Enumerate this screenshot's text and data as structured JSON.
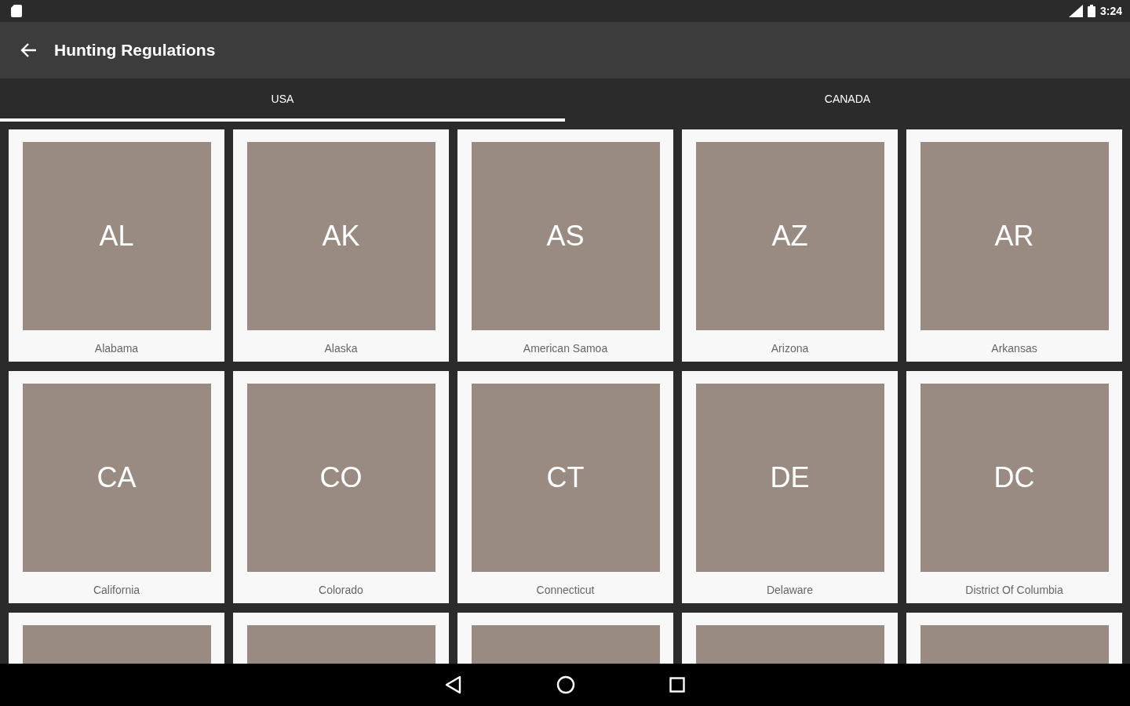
{
  "status_bar": {
    "time": "3:24"
  },
  "app_bar": {
    "title": "Hunting Regulations"
  },
  "tabs": [
    {
      "label": "USA",
      "selected": true
    },
    {
      "label": "CANADA",
      "selected": false
    }
  ],
  "cards": [
    {
      "kind": "state",
      "code": "AL",
      "name": "Alabama"
    },
    {
      "kind": "state",
      "code": "AK",
      "name": "Alaska"
    },
    {
      "kind": "state",
      "code": "AS",
      "name": "American Samoa"
    },
    {
      "kind": "state",
      "code": "AZ",
      "name": "Arizona"
    },
    {
      "kind": "state",
      "code": "AR",
      "name": "Arkansas"
    },
    {
      "kind": "state",
      "code": "CA",
      "name": "California"
    },
    {
      "kind": "state",
      "code": "CO",
      "name": "Colorado"
    },
    {
      "kind": "state",
      "code": "CT",
      "name": "Connecticut"
    },
    {
      "kind": "state",
      "code": "DE",
      "name": "Delaware"
    },
    {
      "kind": "state",
      "code": "DC",
      "name": "District Of Columbia"
    },
    {
      "kind": "blank"
    },
    {
      "kind": "blank"
    },
    {
      "kind": "blank"
    },
    {
      "kind": "blank"
    },
    {
      "kind": "blank"
    }
  ]
}
